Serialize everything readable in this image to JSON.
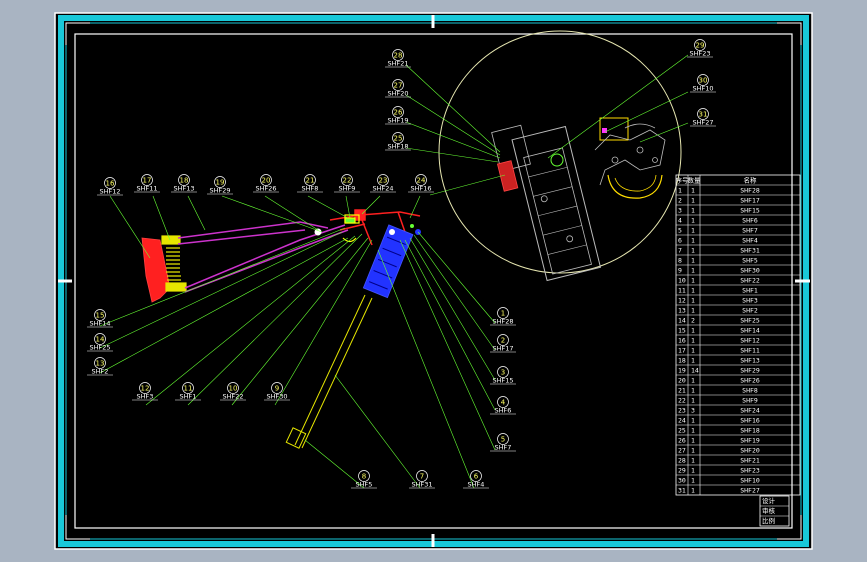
{
  "drawing": {
    "colors": {
      "background": "#000000",
      "border": "#19c8d8",
      "leader": "#66ff33",
      "spring": "#e6e600",
      "stock": "#ff2020",
      "link": "#cc33cc",
      "rail": "#2233ff",
      "circle": "#e6e6b0",
      "trigger": "#ffdd00",
      "text": "#ffffff"
    },
    "balloons": [
      {
        "num": "28",
        "code": "SHF21"
      },
      {
        "num": "27",
        "code": "SHF20"
      },
      {
        "num": "26",
        "code": "SHF19"
      },
      {
        "num": "25",
        "code": "SHF18"
      },
      {
        "num": "29",
        "code": "SHF23"
      },
      {
        "num": "30",
        "code": "SHF10"
      },
      {
        "num": "31",
        "code": "SHF27"
      },
      {
        "num": "16",
        "code": "SHF12"
      },
      {
        "num": "17",
        "code": "SHF11"
      },
      {
        "num": "18",
        "code": "SHF13"
      },
      {
        "num": "19",
        "code": "SHF29"
      },
      {
        "num": "20",
        "code": "SHF26"
      },
      {
        "num": "21",
        "code": "SHF8"
      },
      {
        "num": "22",
        "code": "SHF9"
      },
      {
        "num": "23",
        "code": "SHF24"
      },
      {
        "num": "24",
        "code": "SHF16"
      },
      {
        "num": "15",
        "code": "SHF14"
      },
      {
        "num": "14",
        "code": "SHF25"
      },
      {
        "num": "13",
        "code": "SHF2"
      },
      {
        "num": "12",
        "code": "SHF3"
      },
      {
        "num": "11",
        "code": "SHF1"
      },
      {
        "num": "10",
        "code": "SHF22"
      },
      {
        "num": "9",
        "code": "SHF30"
      },
      {
        "num": "1",
        "code": "SHF28"
      },
      {
        "num": "2",
        "code": "SHF17"
      },
      {
        "num": "3",
        "code": "SHF15"
      },
      {
        "num": "4",
        "code": "SHF6"
      },
      {
        "num": "5",
        "code": "SHF7"
      },
      {
        "num": "8",
        "code": "SHF5"
      },
      {
        "num": "7",
        "code": "SHF31"
      },
      {
        "num": "6",
        "code": "SHF4"
      }
    ],
    "bom": {
      "headers": [
        "序号",
        "数量",
        "名称"
      ],
      "rows": [
        [
          "1",
          "1",
          "SHF28"
        ],
        [
          "2",
          "1",
          "SHF17"
        ],
        [
          "3",
          "1",
          "SHF15"
        ],
        [
          "4",
          "1",
          "SHF6"
        ],
        [
          "5",
          "1",
          "SHF7"
        ],
        [
          "6",
          "1",
          "SHF4"
        ],
        [
          "7",
          "1",
          "SHF31"
        ],
        [
          "8",
          "1",
          "SHF5"
        ],
        [
          "9",
          "1",
          "SHF30"
        ],
        [
          "10",
          "1",
          "SHF22"
        ],
        [
          "11",
          "1",
          "SHF1"
        ],
        [
          "12",
          "1",
          "SHF3"
        ],
        [
          "13",
          "1",
          "SHF2"
        ],
        [
          "14",
          "2",
          "SHF25"
        ],
        [
          "15",
          "1",
          "SHF14"
        ],
        [
          "16",
          "1",
          "SHF12"
        ],
        [
          "17",
          "1",
          "SHF11"
        ],
        [
          "18",
          "1",
          "SHF13"
        ],
        [
          "19",
          "14",
          "SHF29"
        ],
        [
          "20",
          "1",
          "SHF26"
        ],
        [
          "21",
          "1",
          "SHF8"
        ],
        [
          "22",
          "1",
          "SHF9"
        ],
        [
          "23",
          "3",
          "SHF24"
        ],
        [
          "24",
          "1",
          "SHF16"
        ],
        [
          "25",
          "1",
          "SHF18"
        ],
        [
          "26",
          "1",
          "SHF19"
        ],
        [
          "27",
          "1",
          "SHF20"
        ],
        [
          "28",
          "1",
          "SHF21"
        ],
        [
          "29",
          "1",
          "SHF23"
        ],
        [
          "30",
          "1",
          "SHF10"
        ],
        [
          "31",
          "1",
          "SHF27"
        ]
      ]
    },
    "title_block": [
      "设计",
      "审核",
      "比例"
    ]
  }
}
